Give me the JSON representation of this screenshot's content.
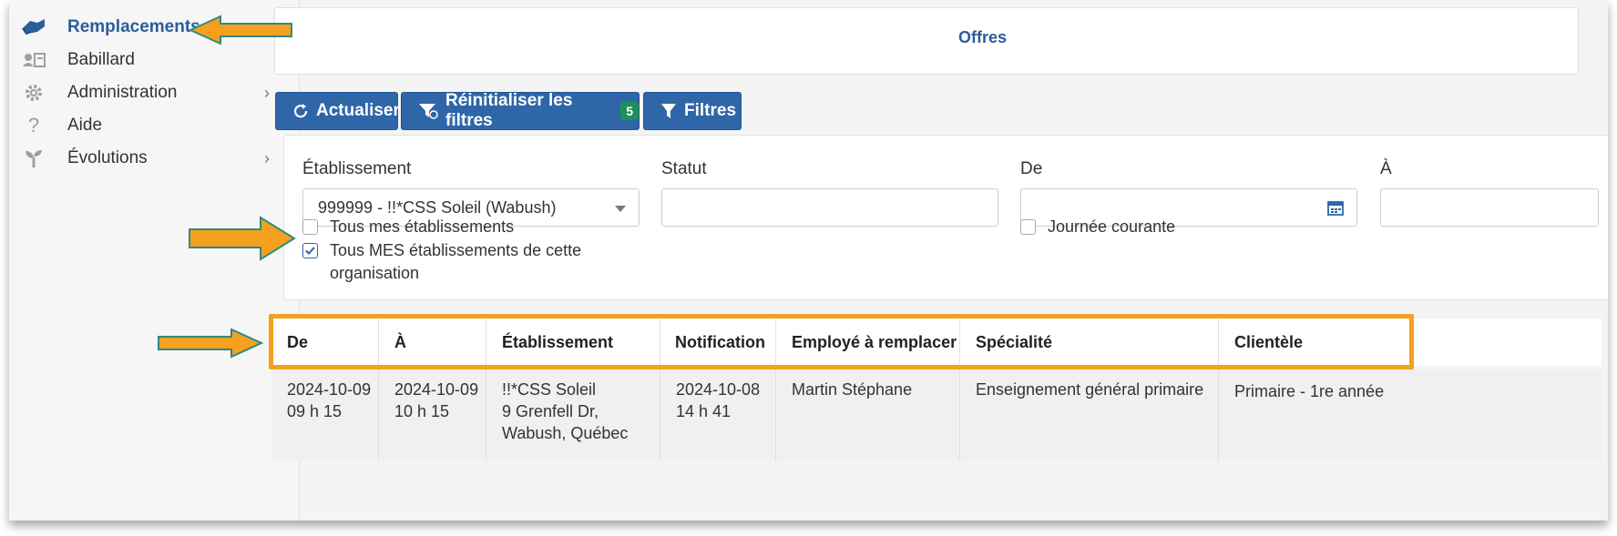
{
  "sidebar": {
    "items": [
      {
        "label": "Remplacements",
        "icon": "handshake-icon",
        "active": true
      },
      {
        "label": "Babillard",
        "icon": "id-card-icon"
      },
      {
        "label": "Administration",
        "icon": "gear-icon",
        "chevron": "›"
      },
      {
        "label": "Aide",
        "icon": "question-icon"
      },
      {
        "label": "Évolutions",
        "icon": "sprout-icon",
        "chevron": "›"
      }
    ]
  },
  "header": {
    "title": "Offres"
  },
  "toolbar": {
    "refresh_label": "Actualiser",
    "reset_label": "Réinitialiser les filtres",
    "reset_badge": "5",
    "filters_label": "Filtres"
  },
  "filters": {
    "establishment": {
      "label": "Établissement",
      "value": "999999 - !!*CSS Soleil (Wabush)",
      "all_mine_label": "Tous mes établissements",
      "all_mine_checked": false,
      "all_org_label_line1": "Tous MES établissements de cette",
      "all_org_label_line2": "organisation",
      "all_org_checked": true
    },
    "status": {
      "label": "Statut",
      "value": ""
    },
    "from": {
      "label": "De",
      "value": "",
      "today_label": "Journée courante",
      "today_checked": false
    },
    "to": {
      "label": "À",
      "value": ""
    }
  },
  "table": {
    "headers": [
      "De",
      "À",
      "Établissement",
      "Notification",
      "Employé à remplacer",
      "Spécialité",
      "Clientèle"
    ],
    "rows": [
      {
        "from": [
          "2024-10-09",
          "09 h 15"
        ],
        "to": [
          "2024-10-09",
          "10 h 15"
        ],
        "establishment": [
          "!!*CSS Soleil",
          "9 Grenfell Dr,",
          "Wabush, Québec"
        ],
        "notification": [
          "2024-10-08",
          "14 h 41"
        ],
        "employee": "Martin Stéphane",
        "specialty": "Enseignement général primaire",
        "clientele": "Primaire - 1re année"
      }
    ]
  },
  "colors": {
    "accent": "#2e66a8",
    "highlight": "#f5a01e",
    "badge": "#1f8f5a",
    "title": "#2a5d9c"
  }
}
